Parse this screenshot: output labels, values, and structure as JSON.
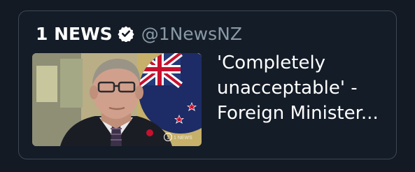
{
  "tweet_card": {
    "display_name": "1 NEWS",
    "handle": "@1NewsNZ",
    "verified_icon": "verified-badge-icon",
    "headline_lines": [
      "'Completely",
      "unacceptable' -",
      "Foreign Minister..."
    ],
    "thumbnail": {
      "watermark": "1 NEWS",
      "subject": "news-video-thumbnail"
    }
  },
  "colors": {
    "background": "#131a24",
    "card_border": "#3d4855",
    "text_primary": "#ffffff",
    "text_secondary": "#8899a6"
  }
}
